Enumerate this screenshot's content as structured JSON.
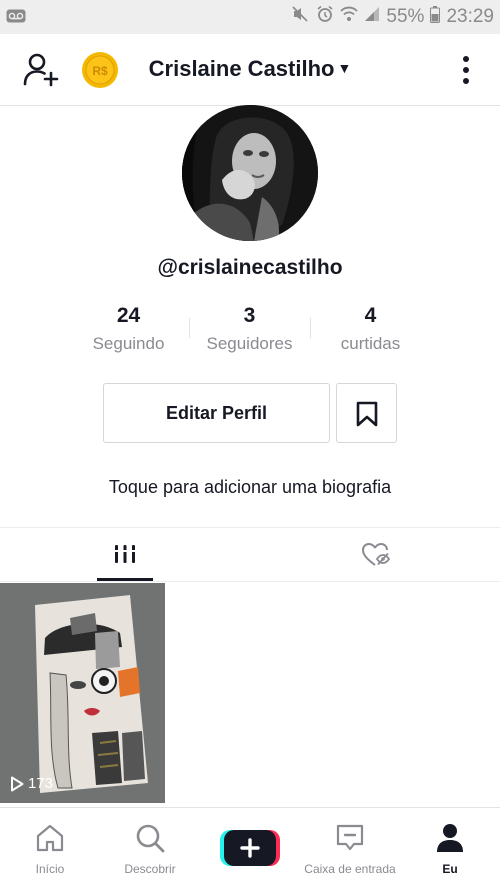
{
  "status_bar": {
    "battery_percent": "55%",
    "time": "23:29"
  },
  "header": {
    "title": "Crislaine Castilho",
    "coin_text": "R$"
  },
  "profile": {
    "username": "@crislainecastilho",
    "stats": [
      {
        "value": "24",
        "label": "Seguindo"
      },
      {
        "value": "3",
        "label": "Seguidores"
      },
      {
        "value": "4",
        "label": "curtidas"
      }
    ],
    "edit_button_label": "Editar Perfil",
    "bio_prompt": "Toque para adicionar uma biografia"
  },
  "tabs": {
    "active": "videos-grid"
  },
  "videos": [
    {
      "play_count": "173"
    }
  ],
  "bottom_nav": {
    "items": [
      {
        "label": "Início",
        "icon": "home-icon"
      },
      {
        "label": "Descobrir",
        "icon": "search-icon"
      },
      {
        "label": "",
        "icon": "plus-icon"
      },
      {
        "label": "Caixa de entrada",
        "icon": "inbox-icon"
      },
      {
        "label": "Eu",
        "icon": "profile-icon"
      }
    ]
  },
  "colors": {
    "text_primary": "#161823",
    "text_secondary": "#8a8b91",
    "border": "#e3e3e4",
    "coin_gold": "#f5b800",
    "create_cyan": "#25f4ee",
    "create_pink": "#fe2c55"
  }
}
